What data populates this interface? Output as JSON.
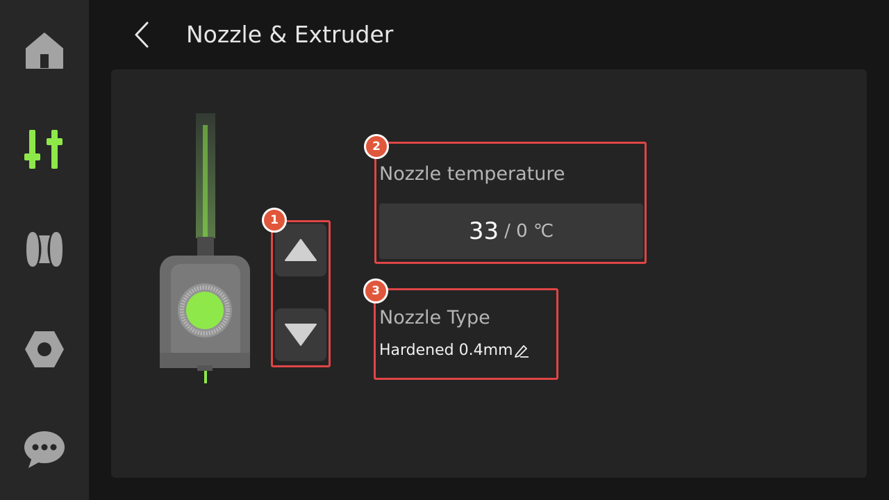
{
  "sidebar": {
    "items": [
      {
        "name": "home",
        "icon": "home-icon",
        "active": false
      },
      {
        "name": "controls",
        "icon": "sliders-icon",
        "active": true
      },
      {
        "name": "filament",
        "icon": "filament-spool-icon",
        "active": false
      },
      {
        "name": "settings",
        "icon": "hex-nut-icon",
        "active": false
      },
      {
        "name": "messages",
        "icon": "chat-bubble-icon",
        "active": false
      }
    ],
    "active_color": "#8ee84a",
    "inactive_color": "#a3a3a3"
  },
  "header": {
    "title": "Nozzle & Extruder",
    "back_icon": "chevron-left-icon"
  },
  "extruder": {
    "move_up_icon": "triangle-up-icon",
    "move_down_icon": "triangle-down-icon",
    "badge": "1"
  },
  "nozzle_temperature": {
    "badge": "2",
    "label": "Nozzle temperature",
    "current": "33",
    "target": "/ 0 ℃"
  },
  "nozzle_type": {
    "badge": "3",
    "label": "Nozzle Type",
    "value": "Hardened 0.4mm",
    "edit_icon": "pencil-icon"
  },
  "colors": {
    "accent": "#8ee84a",
    "highlight_border": "#e04545",
    "badge_fill": "#e0573c"
  }
}
